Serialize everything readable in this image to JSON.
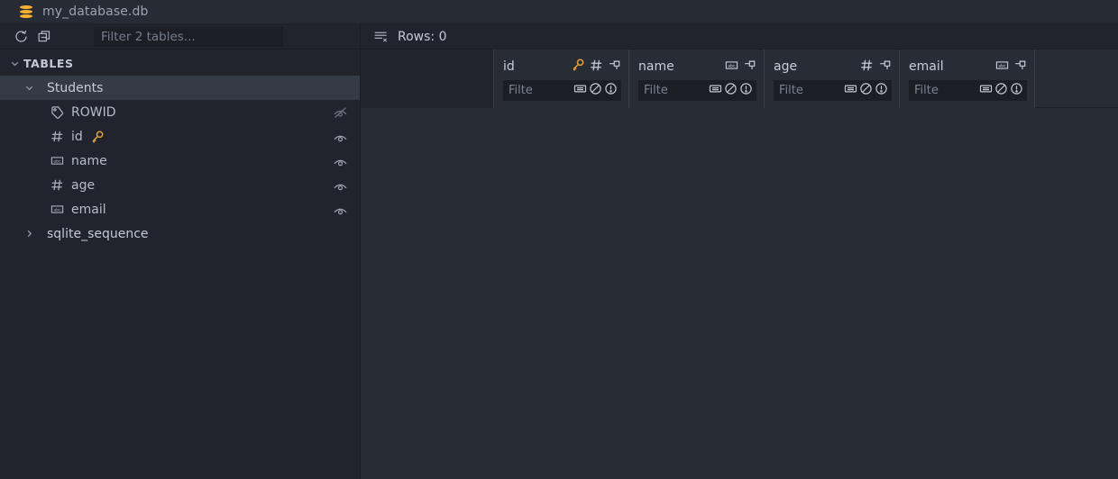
{
  "window": {
    "title": "my_database.db",
    "db_icon": "database-icon",
    "background": "#282c35"
  },
  "sidebar": {
    "toolbar": {
      "refresh_icon": "refresh-icon",
      "refresh_label": "Refresh",
      "collapse_icon": "collapse-all-icon",
      "collapse_label": "Collapse All",
      "filter_placeholder": "Filter 2 tables...",
      "filter_value": ""
    },
    "tree": [
      {
        "label": "TABLES",
        "kind": "group",
        "indent": 1,
        "expanded": true,
        "chevron": "chevron-down-icon",
        "selected": false
      },
      {
        "label": "Students",
        "kind": "table",
        "indent": 2,
        "expanded": true,
        "chevron": "chevron-down-icon",
        "selected": true
      },
      {
        "label": "ROWID",
        "kind": "column",
        "indent": 3,
        "type_icon": "rowid-tag-icon",
        "primary_key": false,
        "visibility": "hidden",
        "visibility_icon": "eye-off-icon"
      },
      {
        "label": "id",
        "kind": "column",
        "indent": 3,
        "type_icon": "number-hash-icon",
        "primary_key": true,
        "key_icon": "key-icon",
        "visibility": "visible",
        "visibility_icon": "eye-icon"
      },
      {
        "label": "name",
        "kind": "column",
        "indent": 3,
        "type_icon": "text-abc-icon",
        "primary_key": false,
        "visibility": "visible",
        "visibility_icon": "eye-icon"
      },
      {
        "label": "age",
        "kind": "column",
        "indent": 3,
        "type_icon": "number-hash-icon",
        "primary_key": false,
        "visibility": "visible",
        "visibility_icon": "eye-icon"
      },
      {
        "label": "email",
        "kind": "column",
        "indent": 3,
        "type_icon": "text-abc-icon",
        "primary_key": false,
        "visibility": "visible",
        "visibility_icon": "eye-icon"
      },
      {
        "label": "sqlite_sequence",
        "kind": "table",
        "indent": 2,
        "expanded": false,
        "chevron": "chevron-right-icon",
        "selected": false
      }
    ]
  },
  "main": {
    "toolbar": {
      "rows_icon": "clear-rows-icon",
      "rows_label": "Rows: 0"
    },
    "grid": {
      "row_count": 0,
      "row_gutter_header": "",
      "columns": [
        {
          "name": "id",
          "type_icon": "number-hash-icon",
          "primary_key": true,
          "key_icon": "key-icon",
          "pin_icon": "pin-icon",
          "filter_placeholder": "Filte",
          "filter_value": "",
          "filter_icons": [
            "equals-icon",
            "not-allowed-icon",
            "exclamation-icon"
          ]
        },
        {
          "name": "name",
          "type_icon": "text-abc-icon",
          "primary_key": false,
          "pin_icon": "pin-icon",
          "filter_placeholder": "Filte",
          "filter_value": "",
          "filter_icons": [
            "equals-icon",
            "not-allowed-icon",
            "exclamation-icon"
          ]
        },
        {
          "name": "age",
          "type_icon": "number-hash-icon",
          "primary_key": false,
          "pin_icon": "pin-icon",
          "filter_placeholder": "Filte",
          "filter_value": "",
          "filter_icons": [
            "equals-icon",
            "not-allowed-icon",
            "exclamation-icon"
          ]
        },
        {
          "name": "email",
          "type_icon": "text-abc-icon",
          "primary_key": false,
          "pin_icon": "pin-icon",
          "filter_placeholder": "Filte",
          "filter_value": "",
          "filter_icons": [
            "equals-icon",
            "not-allowed-icon",
            "exclamation-icon"
          ]
        }
      ],
      "rows": []
    }
  },
  "colors": {
    "accent": "#e8a33d",
    "sidebar_bg": "#21242c",
    "grid_bg": "#282c35",
    "selection": "#343b47",
    "text": "#c3cad4",
    "muted_text": "#7b8392"
  }
}
